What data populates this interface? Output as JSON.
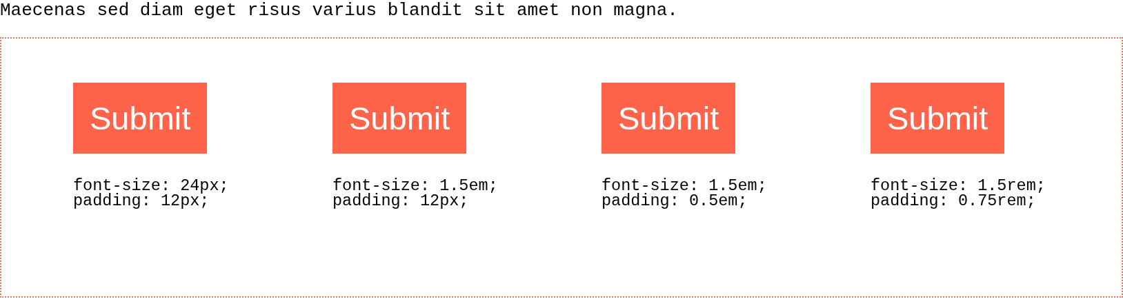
{
  "intro_text": "Maecenas sed diam eget risus varius blandit sit amet non magna.",
  "examples": [
    {
      "button_label": "Submit",
      "code_lines": [
        "font-size: 24px;",
        "padding: 12px;"
      ]
    },
    {
      "button_label": "Submit",
      "code_lines": [
        "font-size: 1.5em;",
        "padding: 12px;"
      ]
    },
    {
      "button_label": "Submit",
      "code_lines": [
        "font-size: 1.5em;",
        "padding: 0.5em;"
      ]
    },
    {
      "button_label": "Submit",
      "code_lines": [
        "font-size: 1.5rem;",
        "padding: 0.75rem;"
      ]
    }
  ]
}
